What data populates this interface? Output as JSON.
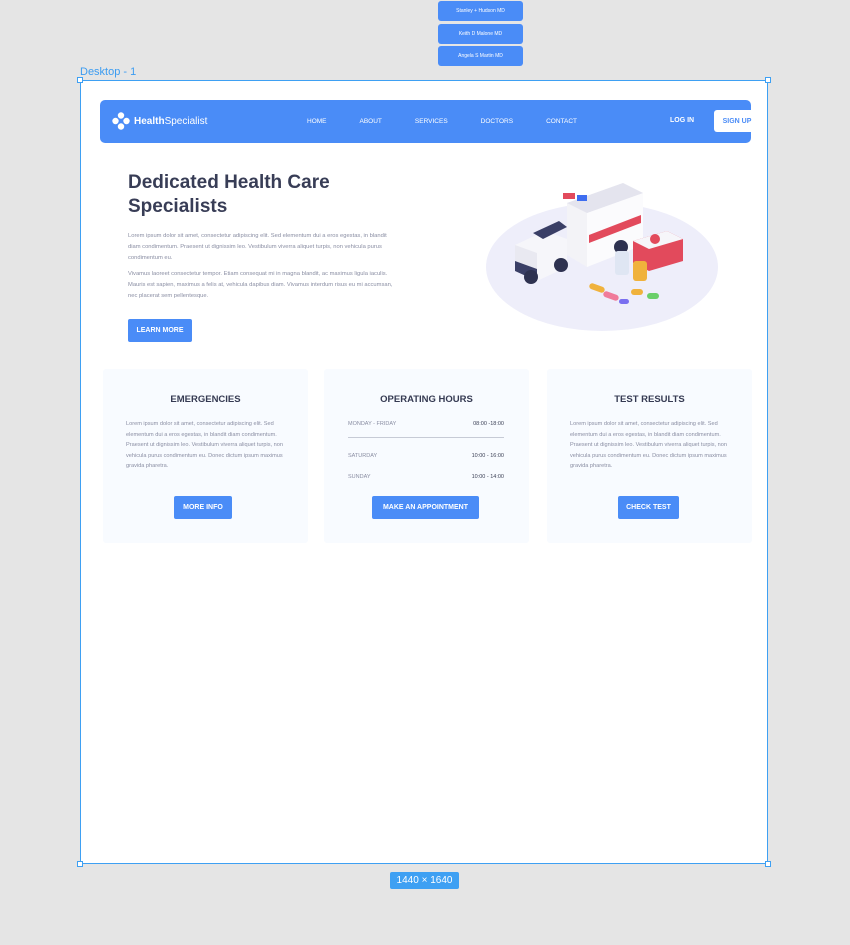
{
  "layers": [
    "Stanley + Hudson MD",
    "Keith D Malone MD",
    "Angela S Martin MD"
  ],
  "frame": {
    "label": "Desktop - 1",
    "size_badge": "1440 × 1640"
  },
  "nav": {
    "brand_bold": "Health",
    "brand_light": "Specialist",
    "links": [
      "HOME",
      "ABOUT",
      "SERVICES",
      "DOCTORS",
      "CONTACT"
    ],
    "login": "LOG IN",
    "signup": "SIGN UP"
  },
  "hero": {
    "title": "Dedicated Health Care Specialists",
    "paragraphs": [
      "Lorem ipsum dolor sit amet, consectetur adipiscing elit. Sed elementum dui a eros egestas, in blandit diam condimentum. Praesent ut dignissim leo. Vestibulum viverra aliquet turpis, non vehicula purus condimentum eu.",
      "Vivamus laoreet consectetur tempor. Etiam consequat mi in magna blandit, ac maximus ligula iaculis. Mauris est sapien, maximus a felis at, vehicula dapibus diam. Vivamus interdum risus eu mi accumsan, nec placerat sem pellentesque."
    ],
    "cta": "LEARN MORE"
  },
  "cards": {
    "emergencies": {
      "title": "EMERGENCIES",
      "text": "Lorem ipsum dolor sit amet, consectetur adipiscing elit. Sed elementum dui a eros egestas, in blandit diam condimentum. Praesent ut dignissim leo. Vestibulum viverra aliquet turpis, non vehicula purus condimentum eu. Donec dictum ipsum maximus gravida pharetra.",
      "button": "MORE INFO"
    },
    "hours": {
      "title": "OPERATING HOURS",
      "rows": [
        {
          "day": "MONDAY - FRIDAY",
          "time": "08:00 -18:00"
        },
        {
          "day": "SATURDAY",
          "time": "10:00 - 16:00"
        },
        {
          "day": "SUNDAY",
          "time": "10:00 - 14:00"
        }
      ],
      "button": "MAKE AN APPOINTMENT"
    },
    "tests": {
      "title": "TEST RESULTS",
      "text": "Lorem ipsum dolor sit amet, consectetur adipiscing elit. Sed elementum dui a eros egestas, in blandit diam condimentum. Praesent ut dignissim leo. Vestibulum viverra aliquet turpis, non vehicula purus condimentum eu. Donec dictum ipsum maximus gravida pharetra.",
      "button": "CHECK TEST"
    }
  },
  "colors": {
    "accent": "#4a8cf7",
    "selection": "#3ea0f3",
    "heading": "#383d56",
    "body_text": "#8a8ea3"
  }
}
